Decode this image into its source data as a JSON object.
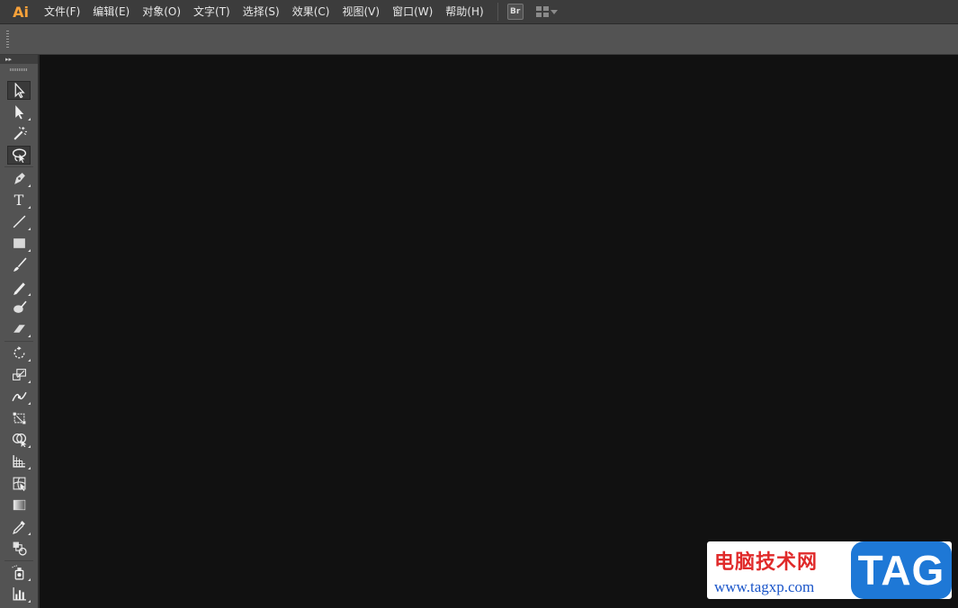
{
  "app": {
    "logo_text": "Ai"
  },
  "menu": [
    {
      "label": "文件(F)"
    },
    {
      "label": "编辑(E)"
    },
    {
      "label": "对象(O)"
    },
    {
      "label": "文字(T)"
    },
    {
      "label": "选择(S)"
    },
    {
      "label": "效果(C)"
    },
    {
      "label": "视图(V)"
    },
    {
      "label": "窗口(W)"
    },
    {
      "label": "帮助(H)"
    }
  ],
  "bridge_button": {
    "label": "Br"
  },
  "workspace_switcher": {
    "icon": "layout-grid-icon"
  },
  "toolbox": {
    "collapse_icon": "double-chevron-icon",
    "tools": [
      {
        "name": "selection-tool",
        "icon": "arrow-outline-icon",
        "active": true
      },
      {
        "name": "direct-selection-tool",
        "icon": "arrow-filled-icon"
      },
      {
        "name": "magic-wand-tool",
        "icon": "magic-wand-icon"
      },
      {
        "name": "lasso-tool",
        "icon": "lasso-icon",
        "active": true
      },
      {
        "name": "pen-tool",
        "icon": "pen-icon"
      },
      {
        "name": "type-tool",
        "icon": "type-icon",
        "glyph": "T"
      },
      {
        "name": "line-tool",
        "icon": "line-icon"
      },
      {
        "name": "rectangle-tool",
        "icon": "rectangle-icon"
      },
      {
        "name": "paintbrush-tool",
        "icon": "paintbrush-icon"
      },
      {
        "name": "pencil-tool",
        "icon": "pencil-icon"
      },
      {
        "name": "blob-brush-tool",
        "icon": "blob-brush-icon"
      },
      {
        "name": "eraser-tool",
        "icon": "eraser-icon"
      },
      {
        "name": "rotate-tool",
        "icon": "rotate-icon"
      },
      {
        "name": "scale-tool",
        "icon": "scale-icon"
      },
      {
        "name": "width-tool",
        "icon": "width-icon"
      },
      {
        "name": "free-transform-tool",
        "icon": "free-transform-icon"
      },
      {
        "name": "shape-builder-tool",
        "icon": "shape-builder-icon"
      },
      {
        "name": "perspective-grid-tool",
        "icon": "perspective-grid-icon"
      },
      {
        "name": "mesh-tool",
        "icon": "mesh-icon"
      },
      {
        "name": "gradient-tool",
        "icon": "gradient-icon"
      },
      {
        "name": "eyedropper-tool",
        "icon": "eyedropper-icon"
      },
      {
        "name": "blend-tool",
        "icon": "blend-icon"
      },
      {
        "name": "symbol-sprayer-tool",
        "icon": "symbol-sprayer-icon"
      },
      {
        "name": "column-graph-tool",
        "icon": "column-graph-icon"
      }
    ]
  },
  "watermark": {
    "title": "电脑技术网",
    "url": "www.tagxp.com",
    "badge": "TAG"
  },
  "colors": {
    "canvas_bg": "#111111",
    "menubar_bg": "#3c3c3c",
    "panel_bg": "#535353",
    "logo": "#f7a13a",
    "watermark_red": "#e02a2a",
    "watermark_blue": "#1e78d6"
  }
}
